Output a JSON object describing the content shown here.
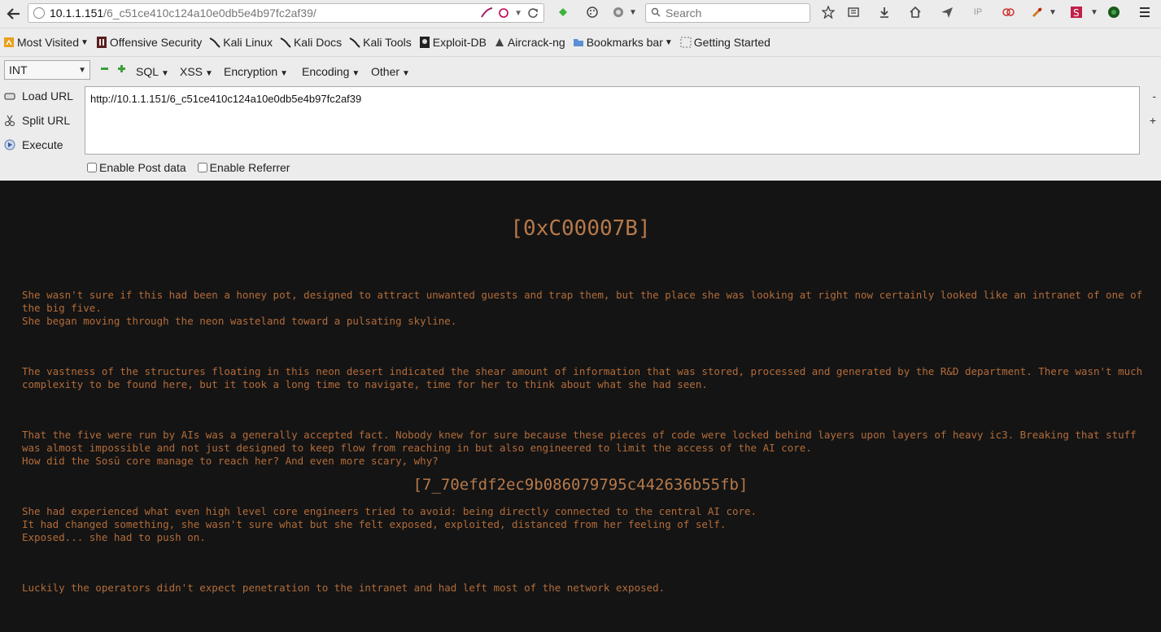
{
  "navbar": {
    "url_host": "10.1.1.151",
    "url_path": "/6_c51ce410c124a10e0db5e4b97fc2af39/",
    "search_placeholder": "Search"
  },
  "bookmarks": [
    {
      "label": "Most Visited",
      "dropdown": true,
      "icon": "most-visited-icon"
    },
    {
      "label": "Offensive Security",
      "icon": "offsec-icon"
    },
    {
      "label": "Kali Linux",
      "icon": "kali-icon"
    },
    {
      "label": "Kali Docs",
      "icon": "kali-icon"
    },
    {
      "label": "Kali Tools",
      "icon": "kali-icon"
    },
    {
      "label": "Exploit-DB",
      "icon": "exploitdb-icon"
    },
    {
      "label": "Aircrack-ng",
      "icon": "aircrack-icon"
    },
    {
      "label": "Bookmarks bar",
      "dropdown": true,
      "icon": "folder-icon"
    },
    {
      "label": "Getting Started",
      "icon": "dotted-square-icon"
    }
  ],
  "hackbar": {
    "select_value": "INT",
    "menus": [
      "SQL",
      "XSS",
      "Encryption",
      "Encoding",
      "Other"
    ],
    "load_url": "Load URL",
    "split_url": "Split URL",
    "execute": "Execute",
    "url_value": "http://10.1.1.151/6_c51ce410c124a10e0db5e4b97fc2af39",
    "enable_post": "Enable Post data",
    "enable_referrer": "Enable Referrer",
    "minus": "-",
    "plus": "+"
  },
  "page": {
    "title": "[0xC00007B]",
    "paragraphs": [
      "She wasn't sure if this had been a honey pot, designed to attract unwanted guests and trap them, but the place she was looking at right now certainly looked like an intranet of one of the big five.\nShe began moving through the neon wasteland toward a pulsating skyline.",
      "The vastness of the structures floating in this neon desert indicated the shear amount of information that was stored, processed and generated by the R&D department. There wasn't much complexity to be found here, but it took a long time to navigate, time for her to think about what she had seen.",
      "That the five were run by AIs was a generally accepted fact. Nobody knew for sure because these pieces of code were locked behind layers upon layers of heavy ic3. Breaking that stuff was almost impossible and not just designed to keep flow from reaching in but also engineered to limit the access of the AI core.\nHow did the Sosū core manage to reach her? And even more scary, why?",
      "She had experienced what even high level core engineers tried to avoid: being directly connected to the central AI core.\nIt had changed something, she wasn't sure what but she felt exposed, exploited, distanced from her feeling of self.\nExposed... she had to push on.",
      "Luckily the operators didn't expect penetration to the intranet and had left most of the network exposed."
    ],
    "hash": "[7_70efdf2ec9b086079795c442636b55fb]",
    "text_color": "#b36c3a",
    "bg_color": "#141414"
  }
}
